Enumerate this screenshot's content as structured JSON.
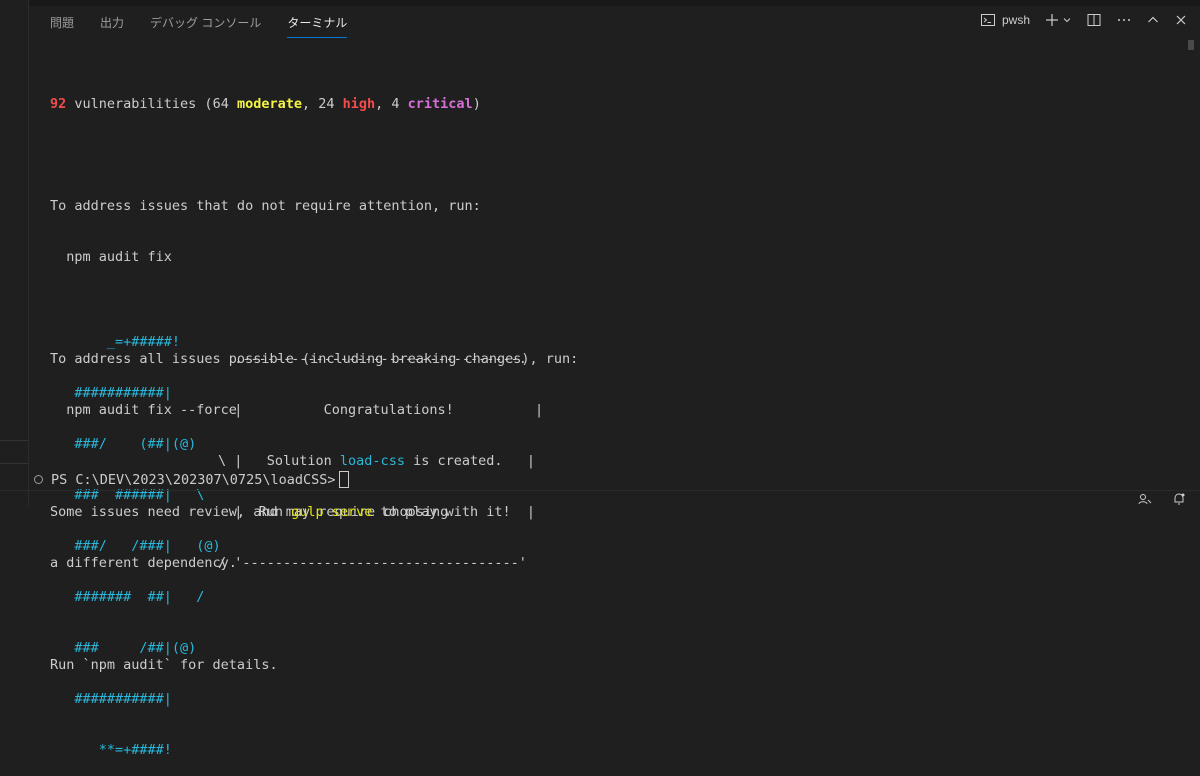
{
  "tabs": [
    {
      "label": "問題"
    },
    {
      "label": "出力"
    },
    {
      "label": "デバッグ コンソール"
    },
    {
      "label": "ターミナル",
      "active": true
    }
  ],
  "toolbar": {
    "shell_label": "pwsh",
    "icons": [
      "terminal-icon",
      "plus-icon",
      "chevron-down-icon",
      "split-icon",
      "more-icon",
      "chevron-up-icon",
      "close-icon"
    ]
  },
  "terminal": {
    "vuln": {
      "count": "92",
      "text1": " vulnerabilities (64 ",
      "moderate": "moderate",
      "text2": ", 24 ",
      "high": "high",
      "text3": ", 4 ",
      "critical": "critical",
      "text4": ")"
    },
    "lines1": [
      "To address issues that do not require attention, run:",
      "  npm audit fix"
    ],
    "lines2": [
      "To address all issues possible (including breaking changes), run:",
      "  npm audit fix --force"
    ],
    "lines3": [
      "Some issues need review, and may require choosing",
      "a different dependency."
    ],
    "lines4": [
      "Run `npm audit` for details."
    ],
    "art": [
      "       _=+#####!",
      "   ###########|",
      "   ###/    (##|(@)",
      "   ###  ######|   \\",
      "   ###/   /###|   (@)",
      "   #######  ##|   /",
      "   ###     /##|(@)",
      "   ###########|",
      "      **=+####!"
    ],
    "box": {
      "top": "  .----------------------------------.",
      "r1_left": "  |",
      "r1_mid": "          Congratulations!          ",
      "r1_right": "|",
      "r2_left": "\\ |   Solution ",
      "r2_name": "load-css",
      "r2_rest": " is created.   |",
      "r3_left": "  |  Run ",
      "r3_cmd": "gulp serve",
      "r3_rest": " to play with it!  |",
      "r4_left": "/ ",
      "bottom": "'----------------------------------'"
    },
    "prompt": "PS C:\\DEV\\2023\\202307\\0725\\loadCSS>"
  },
  "colors": {
    "background": "#1f1f1f",
    "text": "#cccccc",
    "red": "#f14c4c",
    "yellow": "#f5f543",
    "magenta": "#d670d6",
    "cyan": "#29b8db",
    "accent": "#0078d4"
  }
}
